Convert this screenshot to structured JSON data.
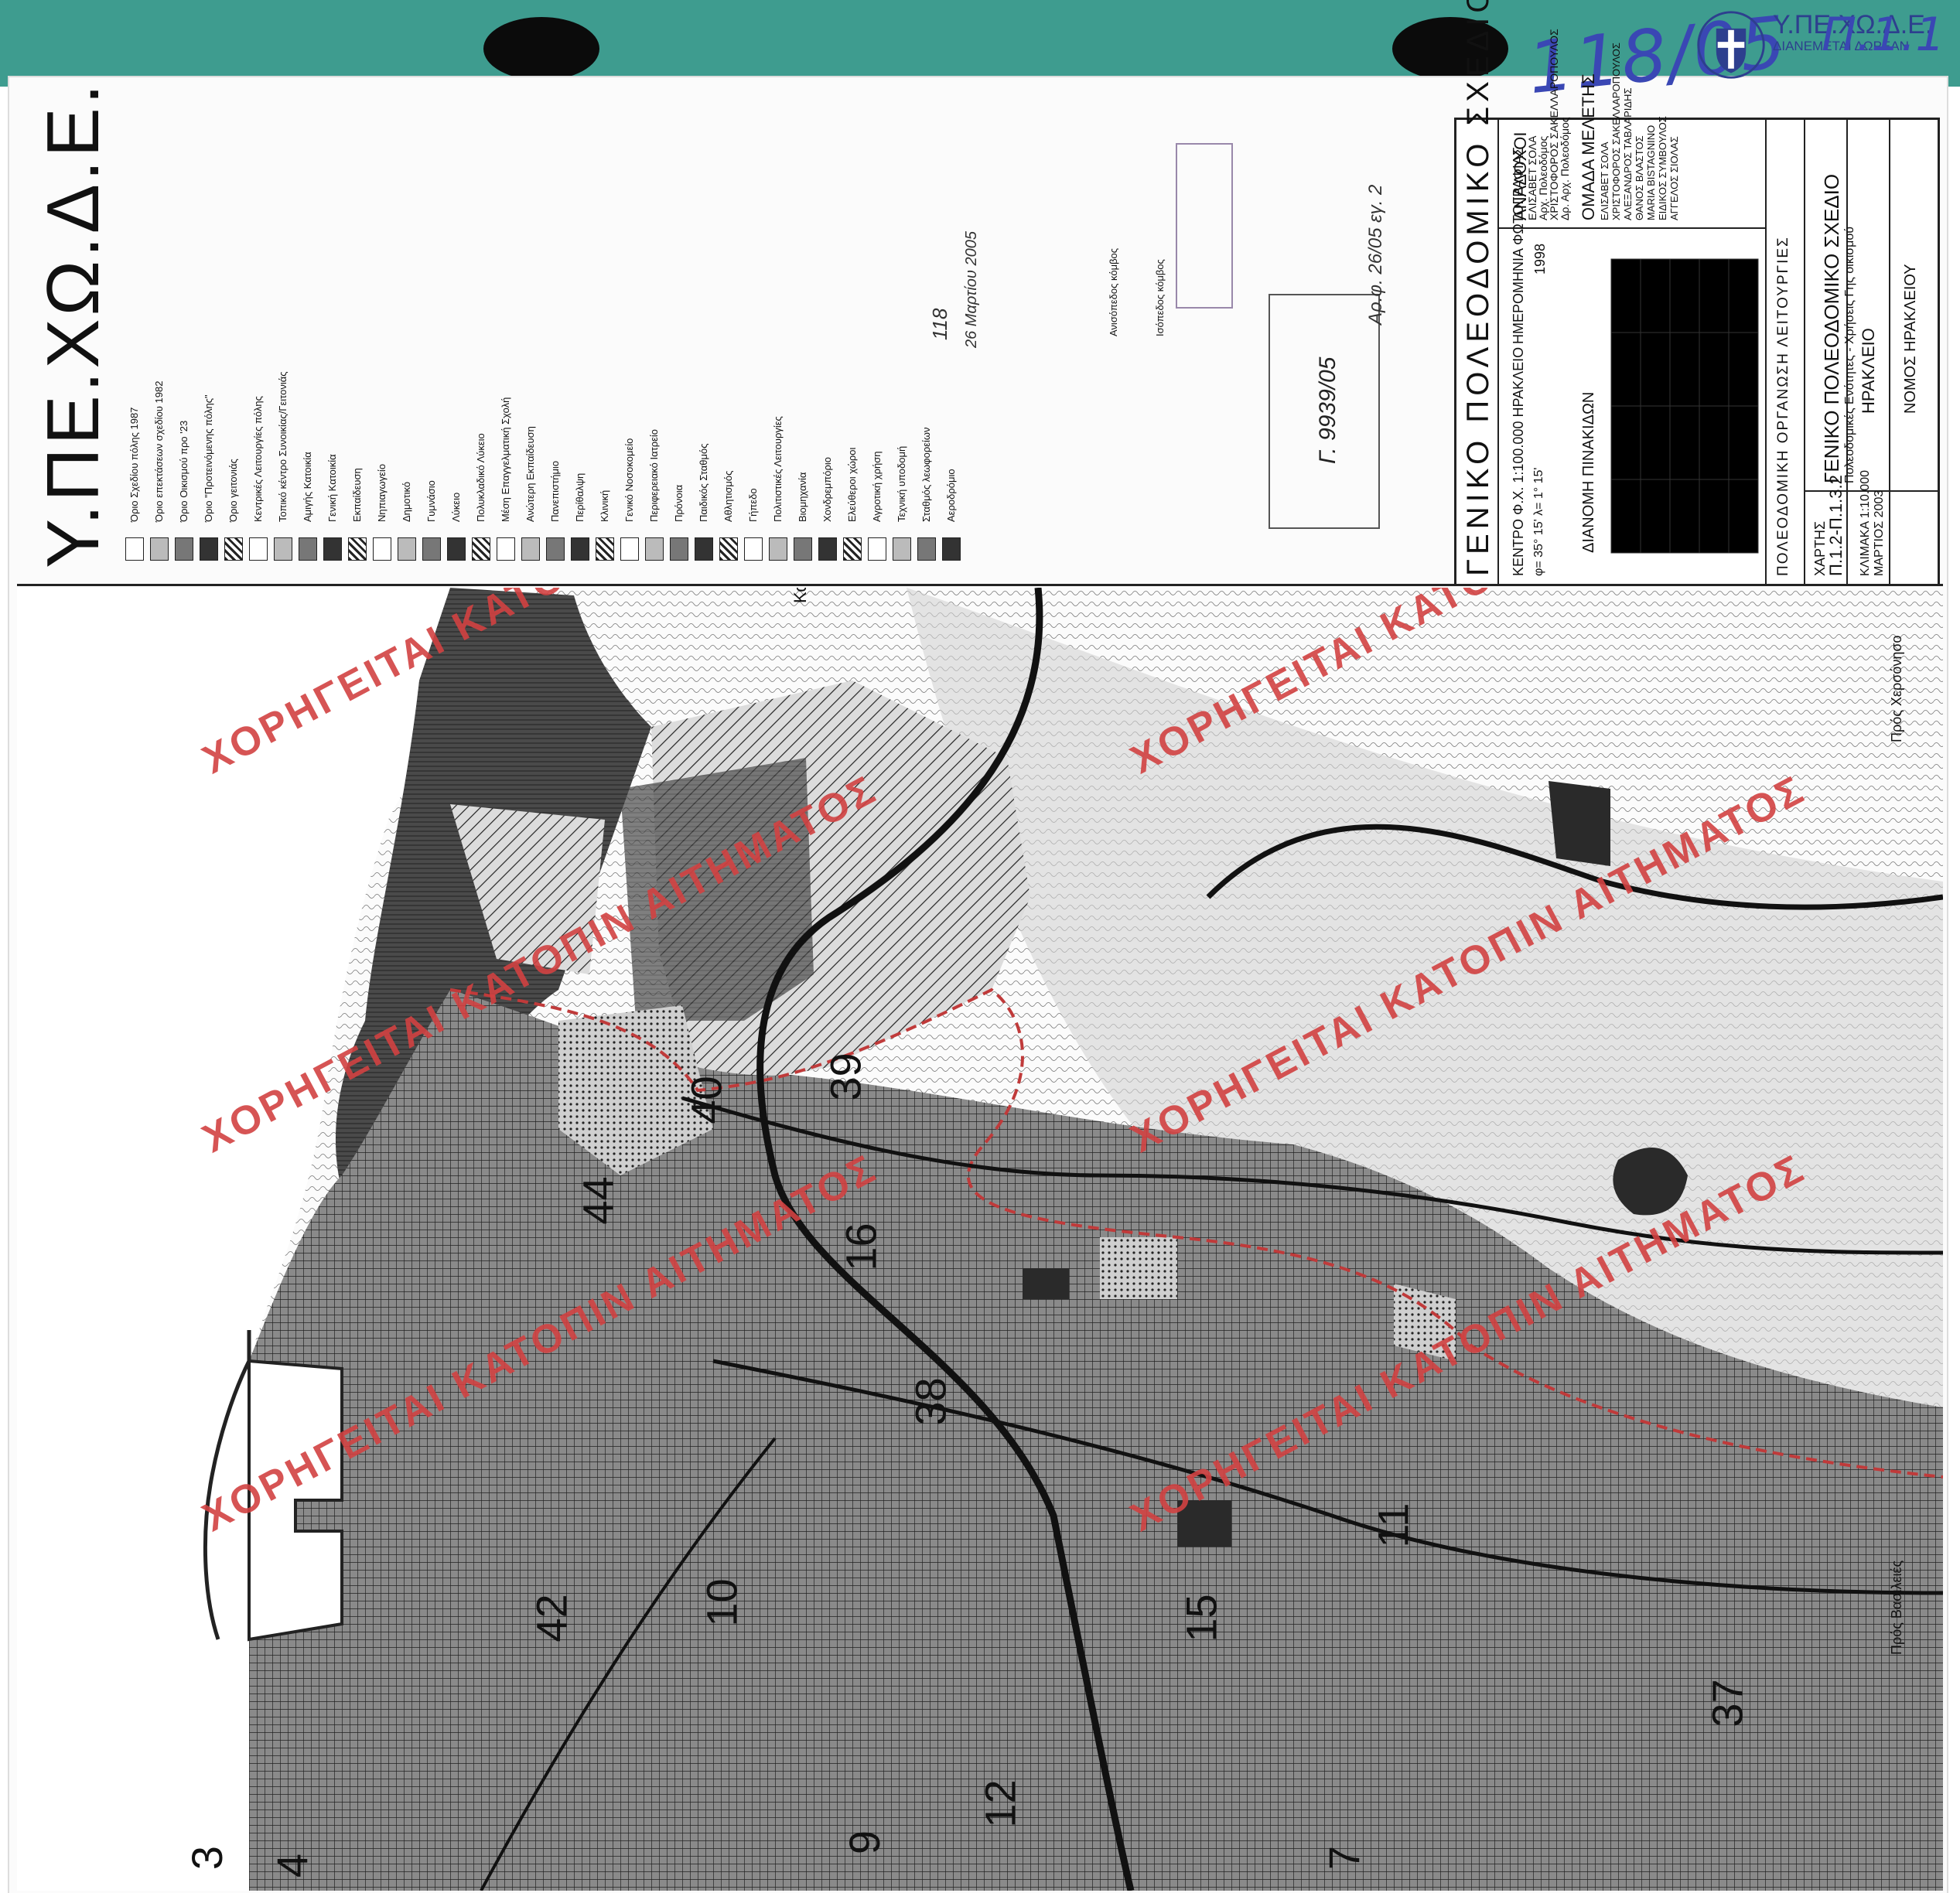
{
  "header": {
    "handwritten_number": "118/05",
    "handwritten_code": "Π.1.1",
    "agency_abbr": "Υ.ΠΕ.ΧΩ.Δ.Ε.",
    "agency_sub": "ΔΙΑΝΕΜΕΤΑΙ ΔΩΡΕΑΝ"
  },
  "legend": {
    "ministry": "Υ.ΠΕ.ΧΩ.Δ.Ε.",
    "items": [
      "Όριο Σχεδίου πόλης 1987",
      "Όριο επεκτάσεων σχεδίου 1982",
      "Όριο Οικισμού προ '23",
      "Όριο \"Προτεινόμενης πόλης\"",
      "Όριο γειτονιάς",
      "Κεντρικές Λειτουργίες πόλης",
      "Τοπικό κέντρο Συνοικίας/Γειτονιάς",
      "Αμιγής Κατοικία",
      "Γενική Κατοικία",
      "Εκπαίδευση",
      "Νηπιαγωγείο",
      "Δημοτικό",
      "Γυμνάσιο",
      "Λύκειο",
      "Πολυκλαδικό Λύκειο",
      "Μέση Επαγγελματική Σχολή",
      "Ανώτερη Εκπαίδευση",
      "Πανεπιστήμιο",
      "Περίθαλψη",
      "Κλινική",
      "Γενικό Νοσοκομείο",
      "Περιφερειακό Ιατρείο",
      "Πρόνοια",
      "Παιδικός Σταθμός",
      "Αθλητισμός",
      "Γήπεδο",
      "Πολιτιστικές Λειτουργίες",
      "Βιομηχανία",
      "Χονδρεμπόριο",
      "Ελεύθεροι χώροι",
      "Αγροτική χρήση",
      "Τεχνική υποδομή",
      "Σταθμός λεωφορείων",
      "Αεροδρόμιο"
    ],
    "junction_labels": [
      "Ανισόπεδος κόμβος",
      "Ισόπεδος κόμβος"
    ]
  },
  "stamps": {
    "receipt": "Γ. 9939/05",
    "receipt_note": "Αρ.φ. 26/05  εγ. 2",
    "number_note": "118",
    "date_note": "26 Μαρτίου 2005"
  },
  "title_block": {
    "plan_title": "ΓΕΝΙΚΟ ΠΟΛΕΟΔΟΜΙΚΟ ΣΧΕΔΙΟ",
    "center": "ΚΕΝΤΡΟ Φ.Χ. 1:100.000 ΗΡΑΚΛΕΙΟ",
    "coords": "φ= 35° 15'  λ= 1° 15'",
    "photo_date": "ΗΜΕΡΟΜΗΝΙΑ ΦΩΤΟΓΡΑΦΙΑΣ",
    "year": "1998",
    "contractors_heading": "ΑΝΑΔΟΧΟΙ",
    "contractors": [
      "ΕΛΙΣΑΒΕΤ ΣΟΛΑ",
      "Αρχ. Πολεοδόμος",
      "ΧΡΙΣΤΟΦΟΡΟΣ ΣΑΚΕΛΛΑΡΟΠΟΥΛΟΣ",
      "Δρ. Αρχ. Πολεοδόμος"
    ],
    "team_heading": "ΟΜΑΔΑ ΜΕΛΕΤΗΣ",
    "team": [
      "ΕΛΙΣΑΒΕΤ ΣΟΛΑ",
      "ΧΡΙΣΤΟΦΟΡΟΣ ΣΑΚΕΛΛΑΡΟΠΟΥΛΟΣ",
      "ΑΛΕΞΑΝΔΡΟΣ ΤΑΒΛΑΡΙΔΗΣ",
      "ΘΑΝΟΣ ΒΛΑΣΤΟΣ",
      "MARIA BISTAGNINO",
      "ΕΙΔΙΚΟΣ ΣΥΜΒΟΥΛΟΣ",
      "ΑΓΓΕΛΟΣ ΣΙΟΛΑΣ"
    ],
    "sheet_index_heading": "ΔΙΑΝΟΜΗ ΠΙΝΑΚΙΔΩΝ",
    "organization": "ΠΟΛΕΟΔΟΜΙΚΗ ΟΡΓΑΝΩΣΗ ΛΕΙΤΟΥΡΓΙΕΣ",
    "map_label": "ΧΑΡΤΗΣ",
    "map_code": "Π.1.2-Π.1.3.2",
    "map_title": "ΓΕΝΙΚΟ ΠΟΛΕΟΔΟΜΙΚΟ ΣΧΕΔΙΟ",
    "map_subtitle": "Πολεοδομικές Ενότητες - Χρήσεις Γης οικισμού",
    "scale": "ΚΛΙΜΑΚΑ 1:10.000",
    "date": "ΜΑΡΤΙΟΣ 2003",
    "city": "ΗΡΑΚΛΕΙΟ",
    "prefecture": "ΝΟΜΟΣ ΗΡΑΚΛΕΙΟΥ"
  },
  "map": {
    "watermark": "ΧΟΡΗΓΕΙΤΑΙ ΚΑΤΟΠΙΝ ΑΙΤΗΜΑΤΟΣ",
    "zones": [
      "44",
      "40",
      "39",
      "16",
      "38",
      "15",
      "37",
      "12",
      "9",
      "4",
      "3",
      "7",
      "42",
      "10",
      "11"
    ],
    "place_labels": [
      "Καρτερός",
      "Πρός Χερσόνησο",
      "Πρός Βασιλειές"
    ]
  },
  "colors": {
    "strip": "#3e9c8f",
    "watermark": "#d24242",
    "handwriting": "#3a47b4",
    "boundary": "#c03a3a"
  }
}
